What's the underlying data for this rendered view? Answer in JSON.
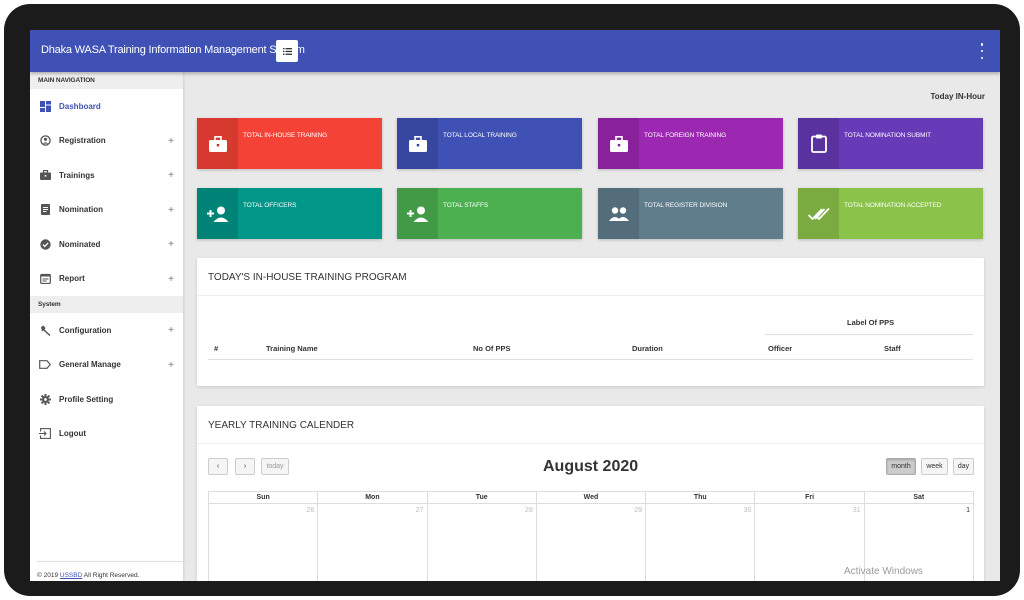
{
  "header": {
    "title": "Dhaka WASA Training Information Management System"
  },
  "sidebar": {
    "section_main": "MAIN NAVIGATION",
    "items_main": [
      {
        "label": "Dashboard",
        "icon": "dashboard-icon"
      },
      {
        "label": "Registration",
        "icon": "user-circle-icon",
        "expand": "+"
      },
      {
        "label": "Trainings",
        "icon": "briefcase-icon",
        "expand": "+"
      },
      {
        "label": "Nomination",
        "icon": "document-icon",
        "expand": "+"
      },
      {
        "label": "Nominated",
        "icon": "check-circle-icon",
        "expand": "+"
      },
      {
        "label": "Report",
        "icon": "calendar-report-icon",
        "expand": "+"
      }
    ],
    "section_system": "System",
    "items_system": [
      {
        "label": "Configuration",
        "icon": "wrench-icon",
        "expand": "+"
      },
      {
        "label": "General Manage",
        "icon": "label-icon",
        "expand": "+"
      },
      {
        "label": "Profile Setting",
        "icon": "gear-icon"
      },
      {
        "label": "Logout",
        "icon": "logout-icon"
      }
    ],
    "footer": {
      "prefix": "© 2019 ",
      "link": "USSBD",
      "suffix": " All Right Reserved."
    }
  },
  "main": {
    "today_label": "Today IN-Hour",
    "tiles": [
      {
        "label": "TOTAL IN-HOUSE TRAINING",
        "color": "#f44336"
      },
      {
        "label": "TOTAL LOCAL TRAINING",
        "color": "#3f51b5"
      },
      {
        "label": "TOTAL FOREIGN TRAINING",
        "color": "#9c27b0"
      },
      {
        "label": "TOTAL NOMINATION SUBMIT",
        "color": "#673ab7"
      },
      {
        "label": "TOTAL OFFICERS",
        "color": "#009688"
      },
      {
        "label": "TOTAL STAFFS",
        "color": "#4caf50"
      },
      {
        "label": "TOTAL REGISTER DIVISION",
        "color": "#607d8b"
      },
      {
        "label": "TOTAL NOMINATION ACCEPTED",
        "color": "#8bc34a"
      }
    ],
    "program": {
      "title": "TODAY'S IN-HOUSE TRAINING PROGRAM",
      "group_header": "Label Of PPS",
      "columns": [
        "#",
        "Training Name",
        "No Of PPS",
        "Duration",
        "Officer",
        "Staff"
      ]
    },
    "calendar": {
      "title": "YEARLY TRAINING CALENDER",
      "month": "August 2020",
      "buttons": {
        "prev": "‹",
        "next": "›",
        "today": "today",
        "month": "month",
        "week": "week",
        "day": "day"
      },
      "weekdays": [
        "Sun",
        "Mon",
        "Tue",
        "Wed",
        "Thu",
        "Fri",
        "Sat"
      ],
      "first_row": [
        "26",
        "27",
        "28",
        "29",
        "30",
        "31",
        "1"
      ]
    }
  },
  "watermark": "Activate Windows"
}
